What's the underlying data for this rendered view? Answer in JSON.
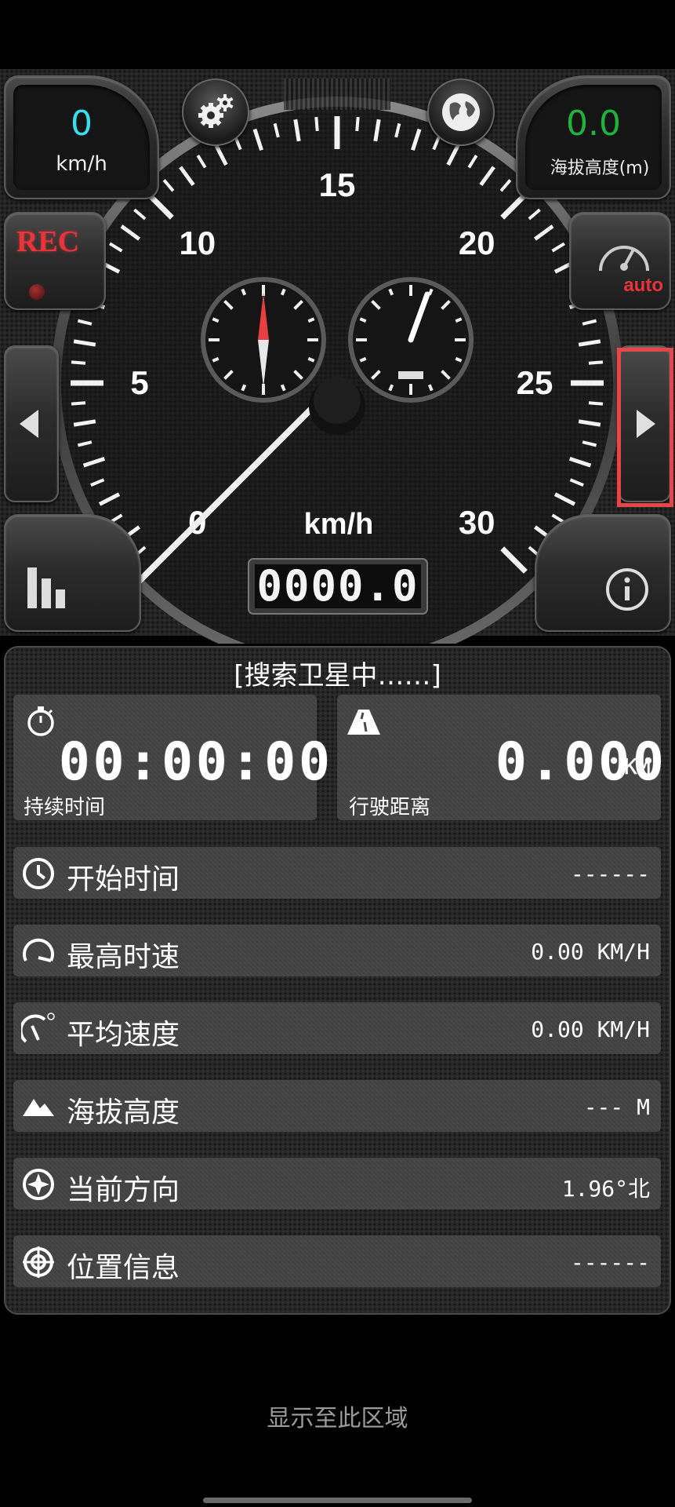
{
  "speed_display": {
    "value": "0",
    "unit": "km/h",
    "color": "#34e0f0"
  },
  "altitude_display": {
    "value": "0.0",
    "unit": "海拔高度(m)",
    "color": "#1eb33a"
  },
  "rec_button": {
    "label": "REC"
  },
  "auto_button": {
    "label": "auto"
  },
  "gauge": {
    "tick_labels": [
      "0",
      "5",
      "10",
      "15",
      "20",
      "25",
      "30"
    ],
    "unit": "km/h",
    "odometer": "0000.0",
    "speed": 0
  },
  "status": {
    "text": "[搜索卫星中……]"
  },
  "duration": {
    "value": "00:00:00",
    "label": "持续时间"
  },
  "distance": {
    "value": "0.000",
    "unit": "KM",
    "label": "行驶距离"
  },
  "rows": [
    {
      "label": "开始时间",
      "value": "------",
      "icon": "clock-icon"
    },
    {
      "label": "最高时速",
      "value": "0.00 KM/H",
      "icon": "max-speed-icon"
    },
    {
      "label": "平均速度",
      "value": "0.00 KM/H",
      "icon": "avg-speed-icon"
    },
    {
      "label": "海拔高度",
      "value": "--- M",
      "icon": "mountain-icon"
    },
    {
      "label": "当前方向",
      "value": "1.96°北",
      "icon": "compass-icon"
    },
    {
      "label": "位置信息",
      "value": "------",
      "icon": "crosshair-icon"
    }
  ],
  "footer": {
    "text": "显示至此区域"
  },
  "colors": {
    "rec": "#e8343a",
    "auto": "#e8343a",
    "highlight": "#e8454a"
  }
}
